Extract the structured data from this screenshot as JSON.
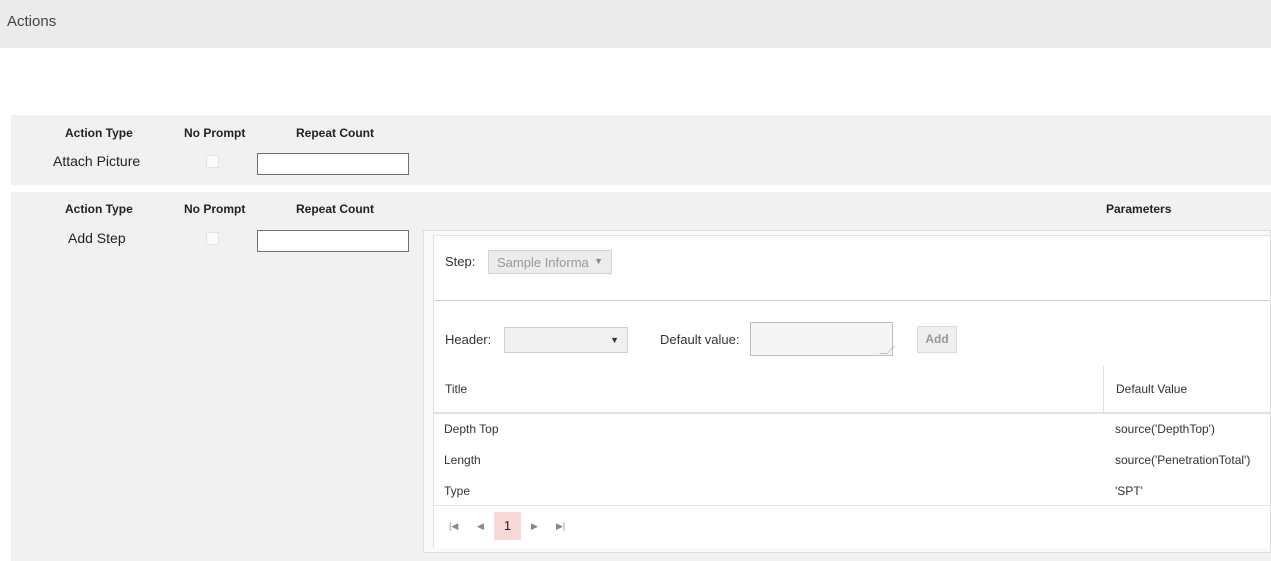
{
  "header": {
    "title": "Actions"
  },
  "actions": [
    {
      "col_action_type": "Action Type",
      "col_no_prompt": "No Prompt",
      "col_repeat_count": "Repeat Count",
      "action_type": "Attach Picture",
      "no_prompt": false,
      "repeat_count": ""
    },
    {
      "col_action_type": "Action Type",
      "col_no_prompt": "No Prompt",
      "col_repeat_count": "Repeat Count",
      "col_parameters": "Parameters",
      "action_type": "Add Step",
      "no_prompt": false,
      "repeat_count": ""
    }
  ],
  "parameters": {
    "step_label": "Step:",
    "step_value": "Sample Informat",
    "header_label": "Header:",
    "header_value": "",
    "default_value_label": "Default value:",
    "default_value": "",
    "add_label": "Add",
    "grid": {
      "columns": [
        "Title",
        "Default Value"
      ],
      "rows": [
        {
          "title": "Depth Top",
          "default_value": "source('DepthTop')"
        },
        {
          "title": "Length",
          "default_value": "source('PenetrationTotal')"
        },
        {
          "title": "Type",
          "default_value": "'SPT'"
        }
      ]
    },
    "pager": {
      "current_page": "1",
      "first_icon": "first-page-icon",
      "prev_icon": "prev-page-icon",
      "next_icon": "next-page-icon",
      "last_icon": "last-page-icon"
    }
  }
}
